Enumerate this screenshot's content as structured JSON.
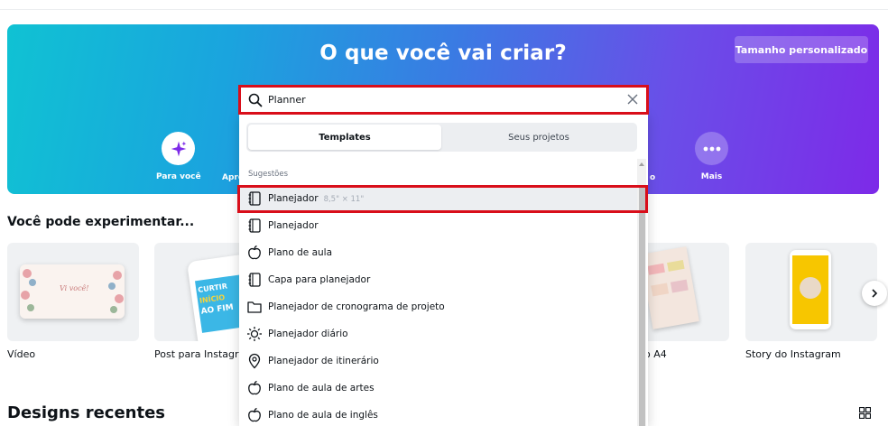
{
  "hero": {
    "title": "O que você vai criar?",
    "custom_size_button": "Tamanho personalizado",
    "categories": {
      "for_you": "Para você",
      "partial_left": "Apre",
      "partial_right": "o",
      "more": "Mais"
    }
  },
  "search": {
    "value": "Planner",
    "tabs": {
      "templates": "Templates",
      "projects": "Seus projetos"
    },
    "suggestions_heading": "Sugestões",
    "suggestions": [
      {
        "label": "Planejador",
        "sub": "8,5\" × 11\"",
        "icon": "notebook-icon"
      },
      {
        "label": "Planejador",
        "icon": "notebook-icon"
      },
      {
        "label": "Plano de aula",
        "icon": "apple-icon"
      },
      {
        "label": "Capa para planejador",
        "icon": "notebook-icon"
      },
      {
        "label": "Planejador de cronograma de projeto",
        "icon": "folder-icon"
      },
      {
        "label": "Planejador diário",
        "icon": "sun-icon"
      },
      {
        "label": "Planejador de itinerário",
        "icon": "location-pin-icon"
      },
      {
        "label": "Plano de aula de artes",
        "icon": "apple-icon"
      },
      {
        "label": "Plano de aula de inglês",
        "icon": "apple-icon"
      }
    ]
  },
  "try_section": {
    "title": "Você pode experimentar...",
    "cards": {
      "video": "Vídeo",
      "instagram_post": "Post para Instagra",
      "a4_partial": "o A4",
      "instagram_story": "Story do Instagram"
    },
    "thumb_texts": {
      "video_script": "Vi você!",
      "curtir": "CURTIR",
      "inicio": "INÍCIO",
      "ao_fim": "AO FIM"
    }
  },
  "recent_section": {
    "title": "Designs recentes"
  },
  "colors": {
    "highlight_border": "#d90e1a",
    "accent": "#7d2ae8"
  }
}
